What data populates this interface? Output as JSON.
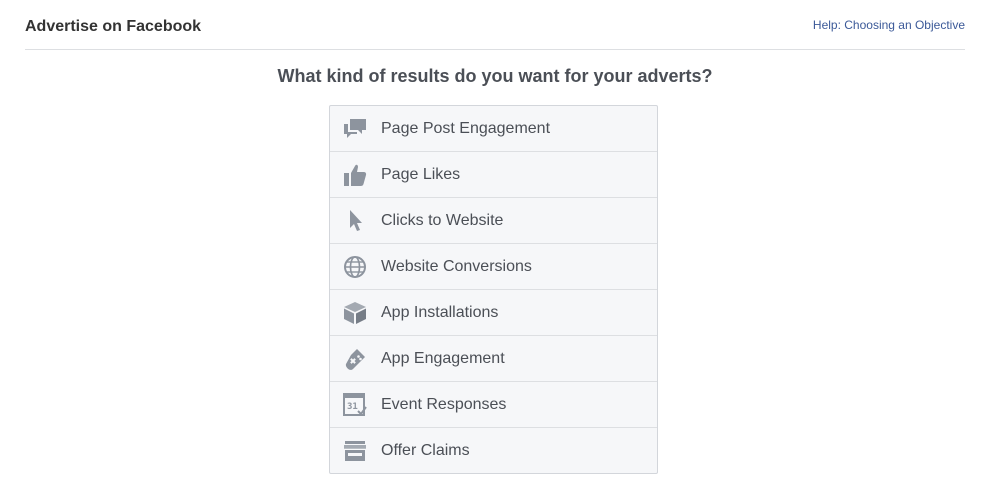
{
  "header": {
    "title": "Advertise on Facebook",
    "help_link": "Help: Choosing an Objective"
  },
  "question": "What kind of results do you want for your adverts?",
  "objectives": [
    {
      "label": "Page Post Engagement",
      "icon": "speech-bubbles-icon"
    },
    {
      "label": "Page Likes",
      "icon": "thumbs-up-icon"
    },
    {
      "label": "Clicks to Website",
      "icon": "cursor-icon"
    },
    {
      "label": "Website Conversions",
      "icon": "globe-icon"
    },
    {
      "label": "App Installations",
      "icon": "box-icon"
    },
    {
      "label": "App Engagement",
      "icon": "gamepad-icon"
    },
    {
      "label": "Event Responses",
      "icon": "calendar-icon"
    },
    {
      "label": "Offer Claims",
      "icon": "store-icon"
    }
  ],
  "calendar_icon_day": "31",
  "colors": {
    "icon": "#8d949e",
    "label": "#4b4f56",
    "link": "#3b5998",
    "list_background": "#f6f7f9"
  }
}
